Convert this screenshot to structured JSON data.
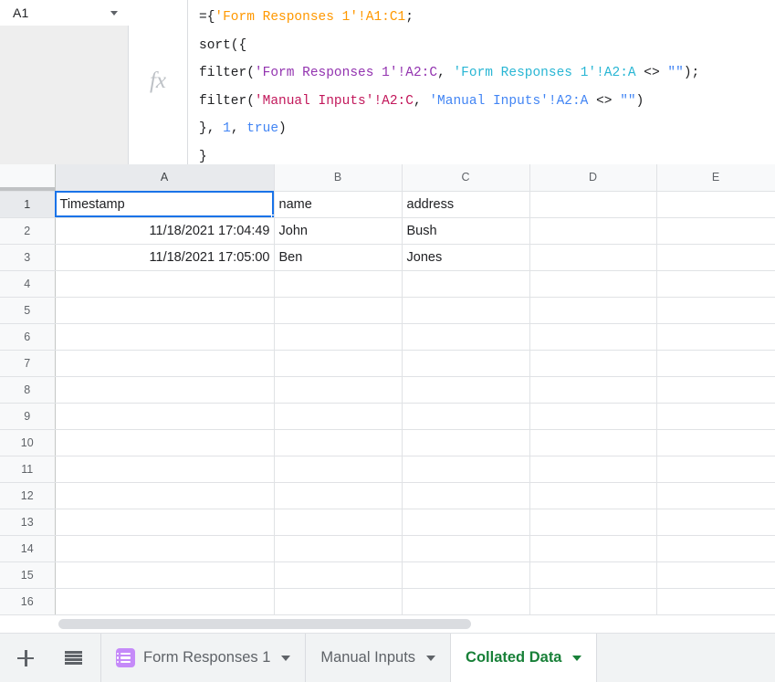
{
  "namebox": {
    "value": "A1",
    "caret_icon": "chevron-down-icon"
  },
  "formula_bar": {
    "fx_icon": "fx-icon",
    "lines": [
      [
        {
          "t": "={",
          "c": "#202124"
        },
        {
          "t": "'Form Responses 1'",
          "c": "#ff9800"
        },
        {
          "t": "!A1:C1",
          "c": "#ff9800"
        },
        {
          "t": ";",
          "c": "#202124"
        }
      ],
      [
        {
          "t": "sort({",
          "c": "#202124"
        }
      ],
      [
        {
          "t": "filter(",
          "c": "#202124"
        },
        {
          "t": "'Form Responses 1'!A2:C",
          "c": "#9334b0"
        },
        {
          "t": ", ",
          "c": "#202124"
        },
        {
          "t": "'Form Responses 1'!A2:A",
          "c": "#29b6d4"
        },
        {
          "t": " <> ",
          "c": "#202124"
        },
        {
          "t": "\"\"",
          "c": "#4285f4"
        },
        {
          "t": ");",
          "c": "#202124"
        }
      ],
      [
        {
          "t": "filter(",
          "c": "#202124"
        },
        {
          "t": "'Manual Inputs'!A2:C",
          "c": "#c2185b"
        },
        {
          "t": ", ",
          "c": "#202124"
        },
        {
          "t": "'Manual Inputs'!A2:A",
          "c": "#4285f4"
        },
        {
          "t": " <> ",
          "c": "#202124"
        },
        {
          "t": "\"\"",
          "c": "#4285f4"
        },
        {
          "t": ")",
          "c": "#202124"
        }
      ],
      [
        {
          "t": "}, ",
          "c": "#202124"
        },
        {
          "t": "1",
          "c": "#4285f4"
        },
        {
          "t": ", ",
          "c": "#202124"
        },
        {
          "t": "true",
          "c": "#4285f4"
        },
        {
          "t": ")",
          "c": "#202124"
        }
      ],
      [
        {
          "t": "}",
          "c": "#202124"
        }
      ]
    ],
    "plain_text": "={'Form Responses 1'!A1:C1;\nsort({\nfilter('Form Responses 1'!A2:C, 'Form Responses 1'!A2:A <> \"\");\nfilter('Manual Inputs'!A2:C, 'Manual Inputs'!A2:A <> \"\")\n}, 1, true)\n}"
  },
  "grid": {
    "column_headers": [
      "A",
      "B",
      "C",
      "D",
      "E"
    ],
    "active_column": "A",
    "active_row": "1",
    "row_numbers": [
      "1",
      "2",
      "3",
      "4",
      "5",
      "6",
      "7",
      "8",
      "9",
      "10",
      "11",
      "12",
      "13",
      "14",
      "15",
      "16"
    ],
    "rows": [
      {
        "n": "1",
        "cells": [
          {
            "v": "Timestamp",
            "align": "left",
            "selected": true
          },
          {
            "v": "name",
            "align": "left"
          },
          {
            "v": "address",
            "align": "left"
          },
          {
            "v": "",
            "align": "left"
          },
          {
            "v": "",
            "align": "left"
          }
        ]
      },
      {
        "n": "2",
        "cells": [
          {
            "v": "11/18/2021 17:04:49",
            "align": "right"
          },
          {
            "v": "John",
            "align": "left"
          },
          {
            "v": "Bush",
            "align": "left"
          },
          {
            "v": "",
            "align": "left"
          },
          {
            "v": "",
            "align": "left"
          }
        ]
      },
      {
        "n": "3",
        "cells": [
          {
            "v": "11/18/2021 17:05:00",
            "align": "right"
          },
          {
            "v": "Ben",
            "align": "left"
          },
          {
            "v": "Jones",
            "align": "left"
          },
          {
            "v": "",
            "align": "left"
          },
          {
            "v": "",
            "align": "left"
          }
        ]
      },
      {
        "n": "4",
        "cells": [
          {
            "v": "",
            "align": "left"
          },
          {
            "v": "",
            "align": "left"
          },
          {
            "v": "",
            "align": "left"
          },
          {
            "v": "",
            "align": "left"
          },
          {
            "v": "",
            "align": "left"
          }
        ]
      },
      {
        "n": "5",
        "cells": [
          {
            "v": "",
            "align": "left"
          },
          {
            "v": "",
            "align": "left"
          },
          {
            "v": "",
            "align": "left"
          },
          {
            "v": "",
            "align": "left"
          },
          {
            "v": "",
            "align": "left"
          }
        ]
      },
      {
        "n": "6",
        "cells": [
          {
            "v": "",
            "align": "left"
          },
          {
            "v": "",
            "align": "left"
          },
          {
            "v": "",
            "align": "left"
          },
          {
            "v": "",
            "align": "left"
          },
          {
            "v": "",
            "align": "left"
          }
        ]
      },
      {
        "n": "7",
        "cells": [
          {
            "v": "",
            "align": "left"
          },
          {
            "v": "",
            "align": "left"
          },
          {
            "v": "",
            "align": "left"
          },
          {
            "v": "",
            "align": "left"
          },
          {
            "v": "",
            "align": "left"
          }
        ]
      },
      {
        "n": "8",
        "cells": [
          {
            "v": "",
            "align": "left"
          },
          {
            "v": "",
            "align": "left"
          },
          {
            "v": "",
            "align": "left"
          },
          {
            "v": "",
            "align": "left"
          },
          {
            "v": "",
            "align": "left"
          }
        ]
      },
      {
        "n": "9",
        "cells": [
          {
            "v": "",
            "align": "left"
          },
          {
            "v": "",
            "align": "left"
          },
          {
            "v": "",
            "align": "left"
          },
          {
            "v": "",
            "align": "left"
          },
          {
            "v": "",
            "align": "left"
          }
        ]
      },
      {
        "n": "10",
        "cells": [
          {
            "v": "",
            "align": "left"
          },
          {
            "v": "",
            "align": "left"
          },
          {
            "v": "",
            "align": "left"
          },
          {
            "v": "",
            "align": "left"
          },
          {
            "v": "",
            "align": "left"
          }
        ]
      },
      {
        "n": "11",
        "cells": [
          {
            "v": "",
            "align": "left"
          },
          {
            "v": "",
            "align": "left"
          },
          {
            "v": "",
            "align": "left"
          },
          {
            "v": "",
            "align": "left"
          },
          {
            "v": "",
            "align": "left"
          }
        ]
      },
      {
        "n": "12",
        "cells": [
          {
            "v": "",
            "align": "left"
          },
          {
            "v": "",
            "align": "left"
          },
          {
            "v": "",
            "align": "left"
          },
          {
            "v": "",
            "align": "left"
          },
          {
            "v": "",
            "align": "left"
          }
        ]
      },
      {
        "n": "13",
        "cells": [
          {
            "v": "",
            "align": "left"
          },
          {
            "v": "",
            "align": "left"
          },
          {
            "v": "",
            "align": "left"
          },
          {
            "v": "",
            "align": "left"
          },
          {
            "v": "",
            "align": "left"
          }
        ]
      },
      {
        "n": "14",
        "cells": [
          {
            "v": "",
            "align": "left"
          },
          {
            "v": "",
            "align": "left"
          },
          {
            "v": "",
            "align": "left"
          },
          {
            "v": "",
            "align": "left"
          },
          {
            "v": "",
            "align": "left"
          }
        ]
      },
      {
        "n": "15",
        "cells": [
          {
            "v": "",
            "align": "left"
          },
          {
            "v": "",
            "align": "left"
          },
          {
            "v": "",
            "align": "left"
          },
          {
            "v": "",
            "align": "left"
          },
          {
            "v": "",
            "align": "left"
          }
        ]
      },
      {
        "n": "16",
        "cells": [
          {
            "v": "",
            "align": "left"
          },
          {
            "v": "",
            "align": "left"
          },
          {
            "v": "",
            "align": "left"
          },
          {
            "v": "",
            "align": "left"
          },
          {
            "v": "",
            "align": "left"
          }
        ]
      }
    ]
  },
  "tabbar": {
    "add_sheet_icon": "plus-icon",
    "all_sheets_icon": "hamburger-icon",
    "tabs": [
      {
        "label": "Form Responses 1",
        "active": false,
        "icon": "google-forms-icon",
        "caret_icon": "chevron-down-icon"
      },
      {
        "label": "Manual Inputs",
        "active": false,
        "icon": null,
        "caret_icon": "chevron-down-icon"
      },
      {
        "label": "Collated Data",
        "active": true,
        "icon": null,
        "caret_icon": "chevron-down-icon"
      }
    ]
  },
  "colors": {
    "selection_blue": "#1a73e8",
    "active_tab_green": "#188038",
    "forms_purple": "#c58af9",
    "header_gray": "#f8f9fa",
    "tabbar_gray": "#f1f3f4"
  }
}
